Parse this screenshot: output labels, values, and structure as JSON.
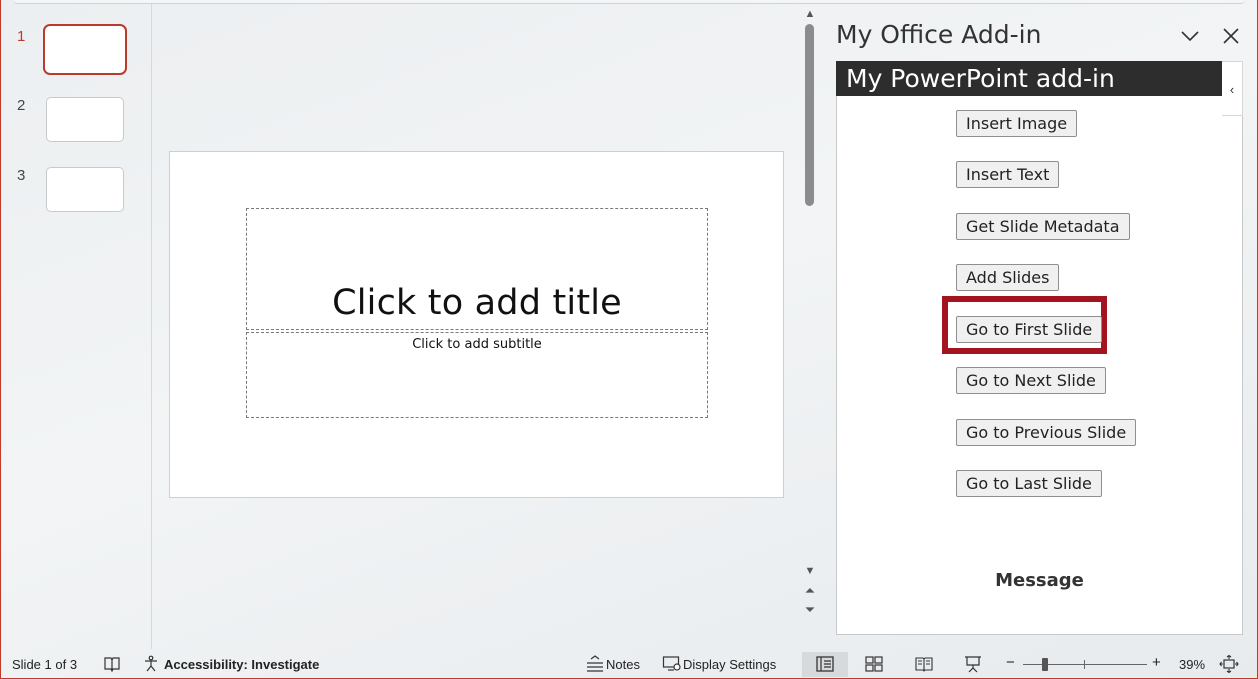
{
  "thumbnails": [
    {
      "number": "1",
      "active": true
    },
    {
      "number": "2",
      "active": false
    },
    {
      "number": "3",
      "active": false
    }
  ],
  "slide": {
    "title_placeholder": "Click to add title",
    "subtitle_placeholder": "Click to add subtitle"
  },
  "taskpane": {
    "title": "My Office Add-in",
    "header": "My PowerPoint add-in",
    "collapse_glyph": "‹",
    "buttons": [
      {
        "label": "Insert Image"
      },
      {
        "label": "Insert Text"
      },
      {
        "label": "Get Slide Metadata"
      },
      {
        "label": "Add Slides"
      },
      {
        "label": "Go to First Slide"
      },
      {
        "label": "Go to Next Slide"
      },
      {
        "label": "Go to Previous Slide"
      },
      {
        "label": "Go to Last Slide"
      }
    ],
    "message_label": "Message"
  },
  "statusbar": {
    "slide_indicator": "Slide 1 of 3",
    "accessibility": "Accessibility: Investigate",
    "notes": "Notes",
    "display_settings": "Display Settings",
    "zoom_minus": "−",
    "zoom_plus": "+",
    "zoom_level": "39%",
    "zoom_value": 0.39
  },
  "colors": {
    "accent": "#b83b2e",
    "highlight": "#a3141e",
    "header_bg": "#2d2d2d"
  },
  "icons": {
    "chevron": "chevron-down-icon",
    "close": "close-icon",
    "spellcheck": "book-check-icon",
    "accessibility": "accessibility-icon",
    "notes": "notes-icon",
    "display": "display-settings-icon",
    "normal_view": "normal-view-icon",
    "sorter_view": "slide-sorter-icon",
    "reading_view": "reading-view-icon",
    "presenter_view": "slideshow-icon",
    "fit": "fit-to-window-icon"
  }
}
